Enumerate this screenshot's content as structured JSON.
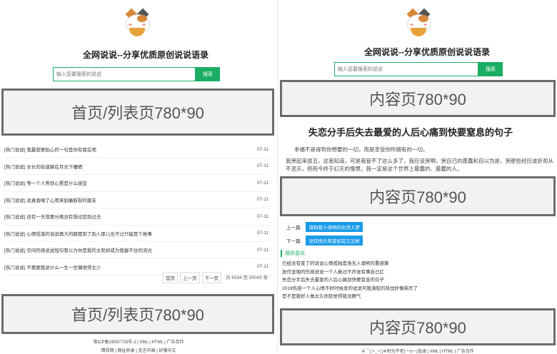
{
  "left": {
    "site_title": "全网说说--分享优质原创说说语录",
    "search": {
      "placeholder": "输入您要搜索的说说",
      "button": "搜索"
    },
    "ad_top": "首页/列表页780*90",
    "ad_bottom": "首页/列表页780*90",
    "list": [
      {
        "title": "[热门说说] 我最想要贴心的一句是你有我在呢",
        "date": "07-11"
      },
      {
        "title": "[热门说说] 长长的街道躺在月光下睡晒",
        "date": "07-11"
      },
      {
        "title": "[热门说说] 等一个人等到心累是什么感受",
        "date": "07-11"
      },
      {
        "title": "[热门说说] 说真香喂了心用来割痛断裂的摸支",
        "date": "07-11"
      },
      {
        "title": "[热门说说] 还有一天就要分离没有想过回到过去",
        "date": "07-11"
      },
      {
        "title": "[热门说说] 心情低落的说说再大的酸楚到了别人那儿也不过只能是个故事",
        "date": "07-11"
      },
      {
        "title": "[热门说说] 空间伤感说说短句管以为你是我的太阳却成为我握不住的流光",
        "date": "07-11"
      },
      {
        "title": "[热门说说] 不要跟我说什么一生一世偶觉得太少",
        "date": "07-11"
      }
    ],
    "pager": {
      "first": "首页",
      "prev": "上一页",
      "next": "下一页",
      "info": "共 6594 页 90089 条"
    },
    "footer": {
      "line1": "粤ICP备19037733号-2 | XML | HTML | 广告合作",
      "line2": "情侣网 | 网址收录 | 无言中国 | 好骚中文"
    }
  },
  "right": {
    "site_title": "全网说说--分享优质原创说说语录",
    "search": {
      "placeholder": "输入您要搜索的说说",
      "button": "搜索"
    },
    "ad_top": "内容页780*90",
    "ad_mid": "内容页780*90",
    "ad_bottom": "内容页780*90",
    "article_title": "失恋分手后失去最爱的人后心痛到快要窒息的句子",
    "para1": "幸福不是得到你想要的一切，而是享受你所拥有的一切。",
    "para2": "我哭起来很丑，这我知道，可是我管不了这么多了，我应该哭啊，哭自己的愚蠢和自以为是，哭那些经历波折却从不泯灭，但而今终于幻灭的憧憬。我一定是这个世界上最蠢的、最蠢的人。",
    "prev_label": "上一篇:",
    "prev_link": "请和我十倍明的女然人梦",
    "next_label": "下一篇:",
    "next_link": "没有快乐笑容如花又怎样",
    "guess_title": "猜你喜欢",
    "guess": [
      "已经没有爱了的说说心情孤独是场无人诸明的重感算",
      "放作坚强的伤感说说一个人挨过不声张有事自己扛",
      "失恋分手后失去最爱的人后心痛到快要窒息的句子",
      "2019伤感一个人心情不好时候发的说说可我满腔的热忱好像耗尽了",
      "是不是我好人做太久你就觉得我没脾气"
    ],
    "footer": "※￣(＞_＜)※时光不老(ㄧoㄧ)加油 | XML | HTML | 广告合作"
  },
  "colors": {
    "accent": "#1aad63",
    "link_bg": "#1a9be8",
    "ad_border": "#6b6b6b"
  }
}
